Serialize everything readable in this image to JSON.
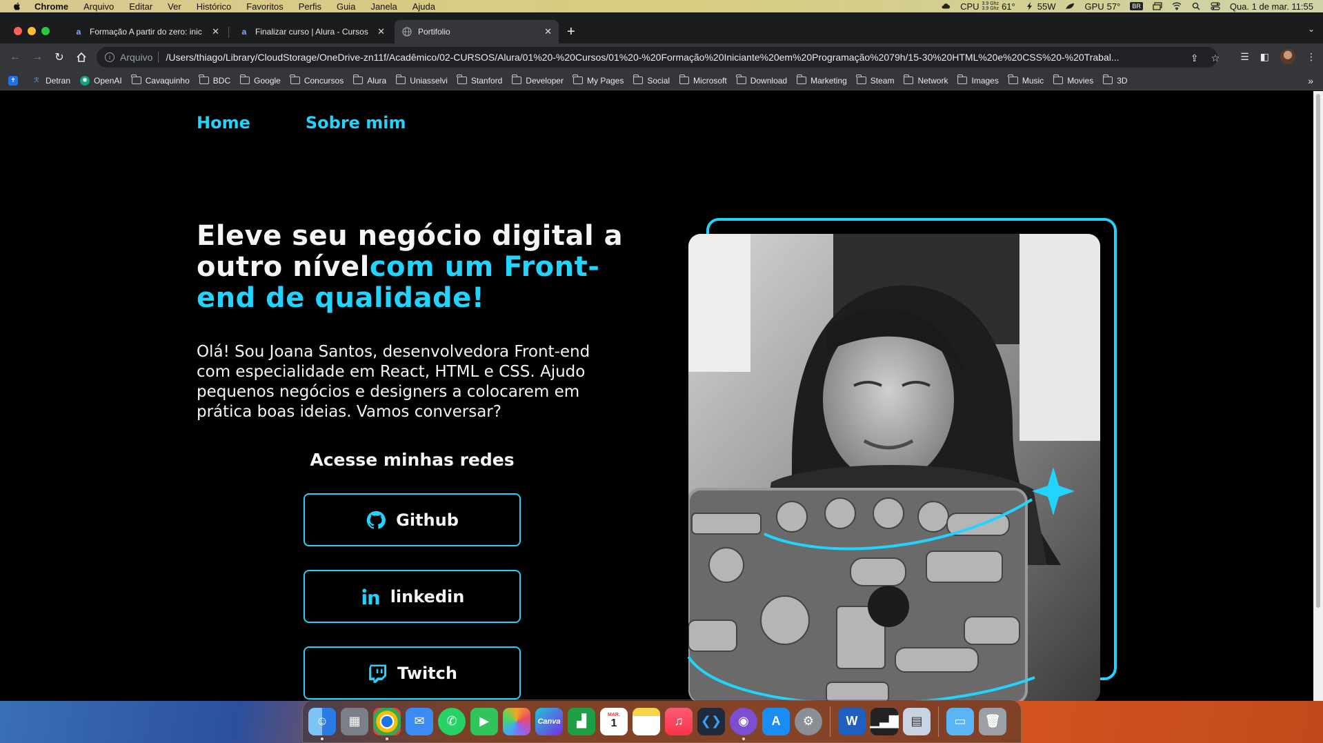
{
  "menubar": {
    "app_name": "Chrome",
    "menus": [
      "Arquivo",
      "Editar",
      "Ver",
      "Histórico",
      "Favoritos",
      "Perfis",
      "Guia",
      "Janela",
      "Ajuda"
    ],
    "cpu_label": "CPU",
    "cpu_freq_1": "3.9 Ghz",
    "cpu_freq_2": "3.9 Ghz",
    "cpu_temp": "61°",
    "power": "55W",
    "gpu_label": "GPU",
    "gpu_temp": "57°",
    "input_source": "BR",
    "datetime": "Qua. 1 de mar.  11:55"
  },
  "browser": {
    "tabs": [
      {
        "title": "Formação A partir do zero: inic",
        "favicon": "a"
      },
      {
        "title": "Finalizar curso | Alura - Cursos",
        "favicon": "a"
      },
      {
        "title": "Portifolio",
        "favicon": "globe"
      }
    ],
    "active_tab": 2,
    "address": {
      "scheme_label": "Arquivo",
      "url": "/Users/thiago/Library/CloudStorage/OneDrive-zn11f/Acadêmico/02-CURSOS/Alura/01%20-%20Cursos/01%20-%20Formação%20Iniciante%20em%20Programação%2079h/15-30%20HTML%20e%20CSS%20-%20Trabal..."
    },
    "bookmarks": [
      "Detran",
      "OpenAI",
      "Cavaquinho",
      "BDC",
      "Google",
      "Concursos",
      "Alura",
      "Uniasselvi",
      "Stanford",
      "Developer",
      "My Pages",
      "Social",
      "Microsoft",
      "Download",
      "Marketing",
      "Steam",
      "Network",
      "Images",
      "Music",
      "Movies",
      "3D"
    ]
  },
  "page": {
    "nav": {
      "home": "Home",
      "about": "Sobre mim"
    },
    "hero": {
      "title_part1": "Eleve seu negócio digital a outro nível",
      "title_part2": "com um Front-end de qualidade!",
      "text": "Olá! Sou Joana Santos, desenvolvedora Front-end com especialidade em React, HTML e CSS. Ajudo pequenos negócios e designers a colocarem em prática boas ideias. Vamos conversar?"
    },
    "networks_title": "Acesse minhas redes",
    "social": [
      {
        "label": "Github",
        "icon": "github-icon"
      },
      {
        "label": "linkedin",
        "icon": "linkedin-icon"
      },
      {
        "label": "Twitch",
        "icon": "twitch-icon"
      }
    ],
    "photo_alt": "Joana Santos",
    "accent_color": "#22d4fd"
  },
  "dock": {
    "apps": [
      "Finder",
      "Launchpad",
      "Chrome",
      "Mail",
      "WhatsApp",
      "FaceTime",
      "Photos",
      "Canva",
      "Numbers",
      "Calendar",
      "Notes",
      "Music",
      "VS Code",
      "GitHub Desktop",
      "App Store",
      "System Settings",
      "Word",
      "Activity Monitor",
      "Preview",
      "Folder",
      "Trash"
    ],
    "calendar_month": "MAR.",
    "calendar_day": "1",
    "canva_label": "Canva"
  }
}
